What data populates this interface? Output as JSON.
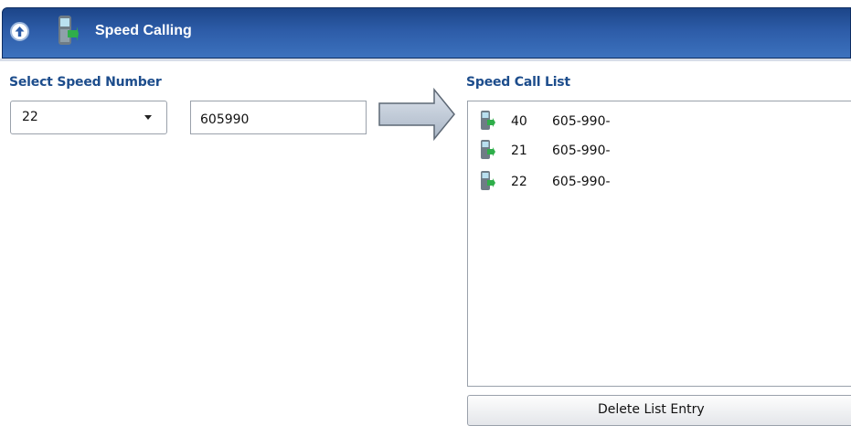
{
  "header": {
    "title": "Speed Calling",
    "up_icon": "up-arrow-circle-icon",
    "app_icon": "phone-handset-icon",
    "bar_color": "#2d5ca8"
  },
  "select_section": {
    "label": "Select Speed Number",
    "selected_value": "22"
  },
  "number_input": {
    "value": "605990"
  },
  "list_section": {
    "label": "Speed Call List",
    "items": [
      {
        "speed_number": "40",
        "phone": "605-990-",
        "icon": "phone-handset-icon"
      },
      {
        "speed_number": "21",
        "phone": "605-990-",
        "icon": "phone-handset-icon"
      },
      {
        "speed_number": "22",
        "phone": "605-990-",
        "icon": "phone-handset-icon"
      }
    ]
  },
  "delete_button": {
    "label": "Delete List Entry"
  },
  "colors": {
    "label_text": "#1d4d8c",
    "border": "#9aa1ab"
  }
}
